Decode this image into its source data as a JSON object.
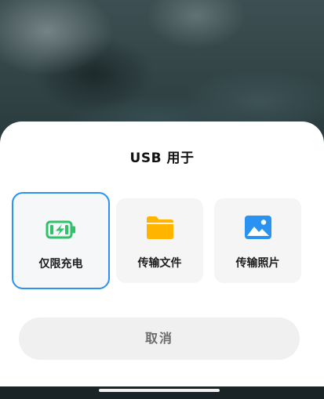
{
  "dialog": {
    "title": "USB 用于",
    "options": [
      {
        "label": "仅限充电",
        "icon": "battery-charging-icon",
        "selected": true,
        "color": "#2fc26a"
      },
      {
        "label": "传输文件",
        "icon": "folder-icon",
        "selected": false,
        "color": "#ffb400"
      },
      {
        "label": "传输照片",
        "icon": "photo-icon",
        "selected": false,
        "color": "#2a93f2"
      }
    ],
    "cancel_label": "取消"
  },
  "colors": {
    "accent": "#2a93f2",
    "sheet_bg": "#ffffff",
    "button_bg": "#f0f0f0"
  }
}
